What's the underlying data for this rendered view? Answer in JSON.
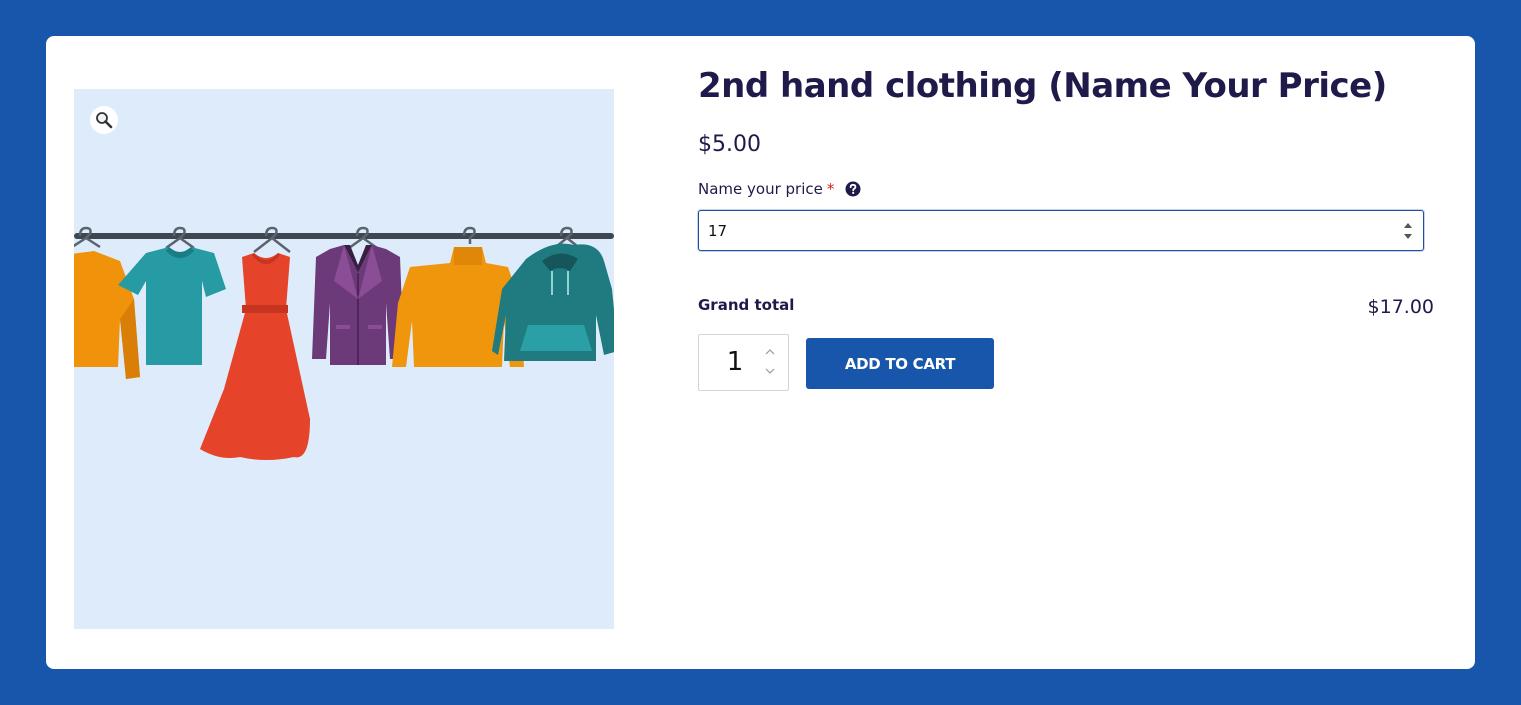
{
  "product": {
    "title": "2nd hand clothing (Name Your Price)",
    "price": "$5.00",
    "image_alt": "clothes-on-rack-illustration"
  },
  "name_your_price": {
    "label": "Name your price",
    "required_marker": "*",
    "value": "17"
  },
  "totals": {
    "grand_total_label": "Grand total",
    "grand_total_value": "$17.00"
  },
  "cart": {
    "quantity": "1",
    "add_to_cart_label": "ADD TO CART"
  },
  "icons": {
    "zoom": "magnifier-icon",
    "help": "question-circle-icon"
  },
  "colors": {
    "page_background": "#1856ab",
    "accent": "#1856ab",
    "heading": "#1e1b4b",
    "image_background": "#deebfb"
  }
}
